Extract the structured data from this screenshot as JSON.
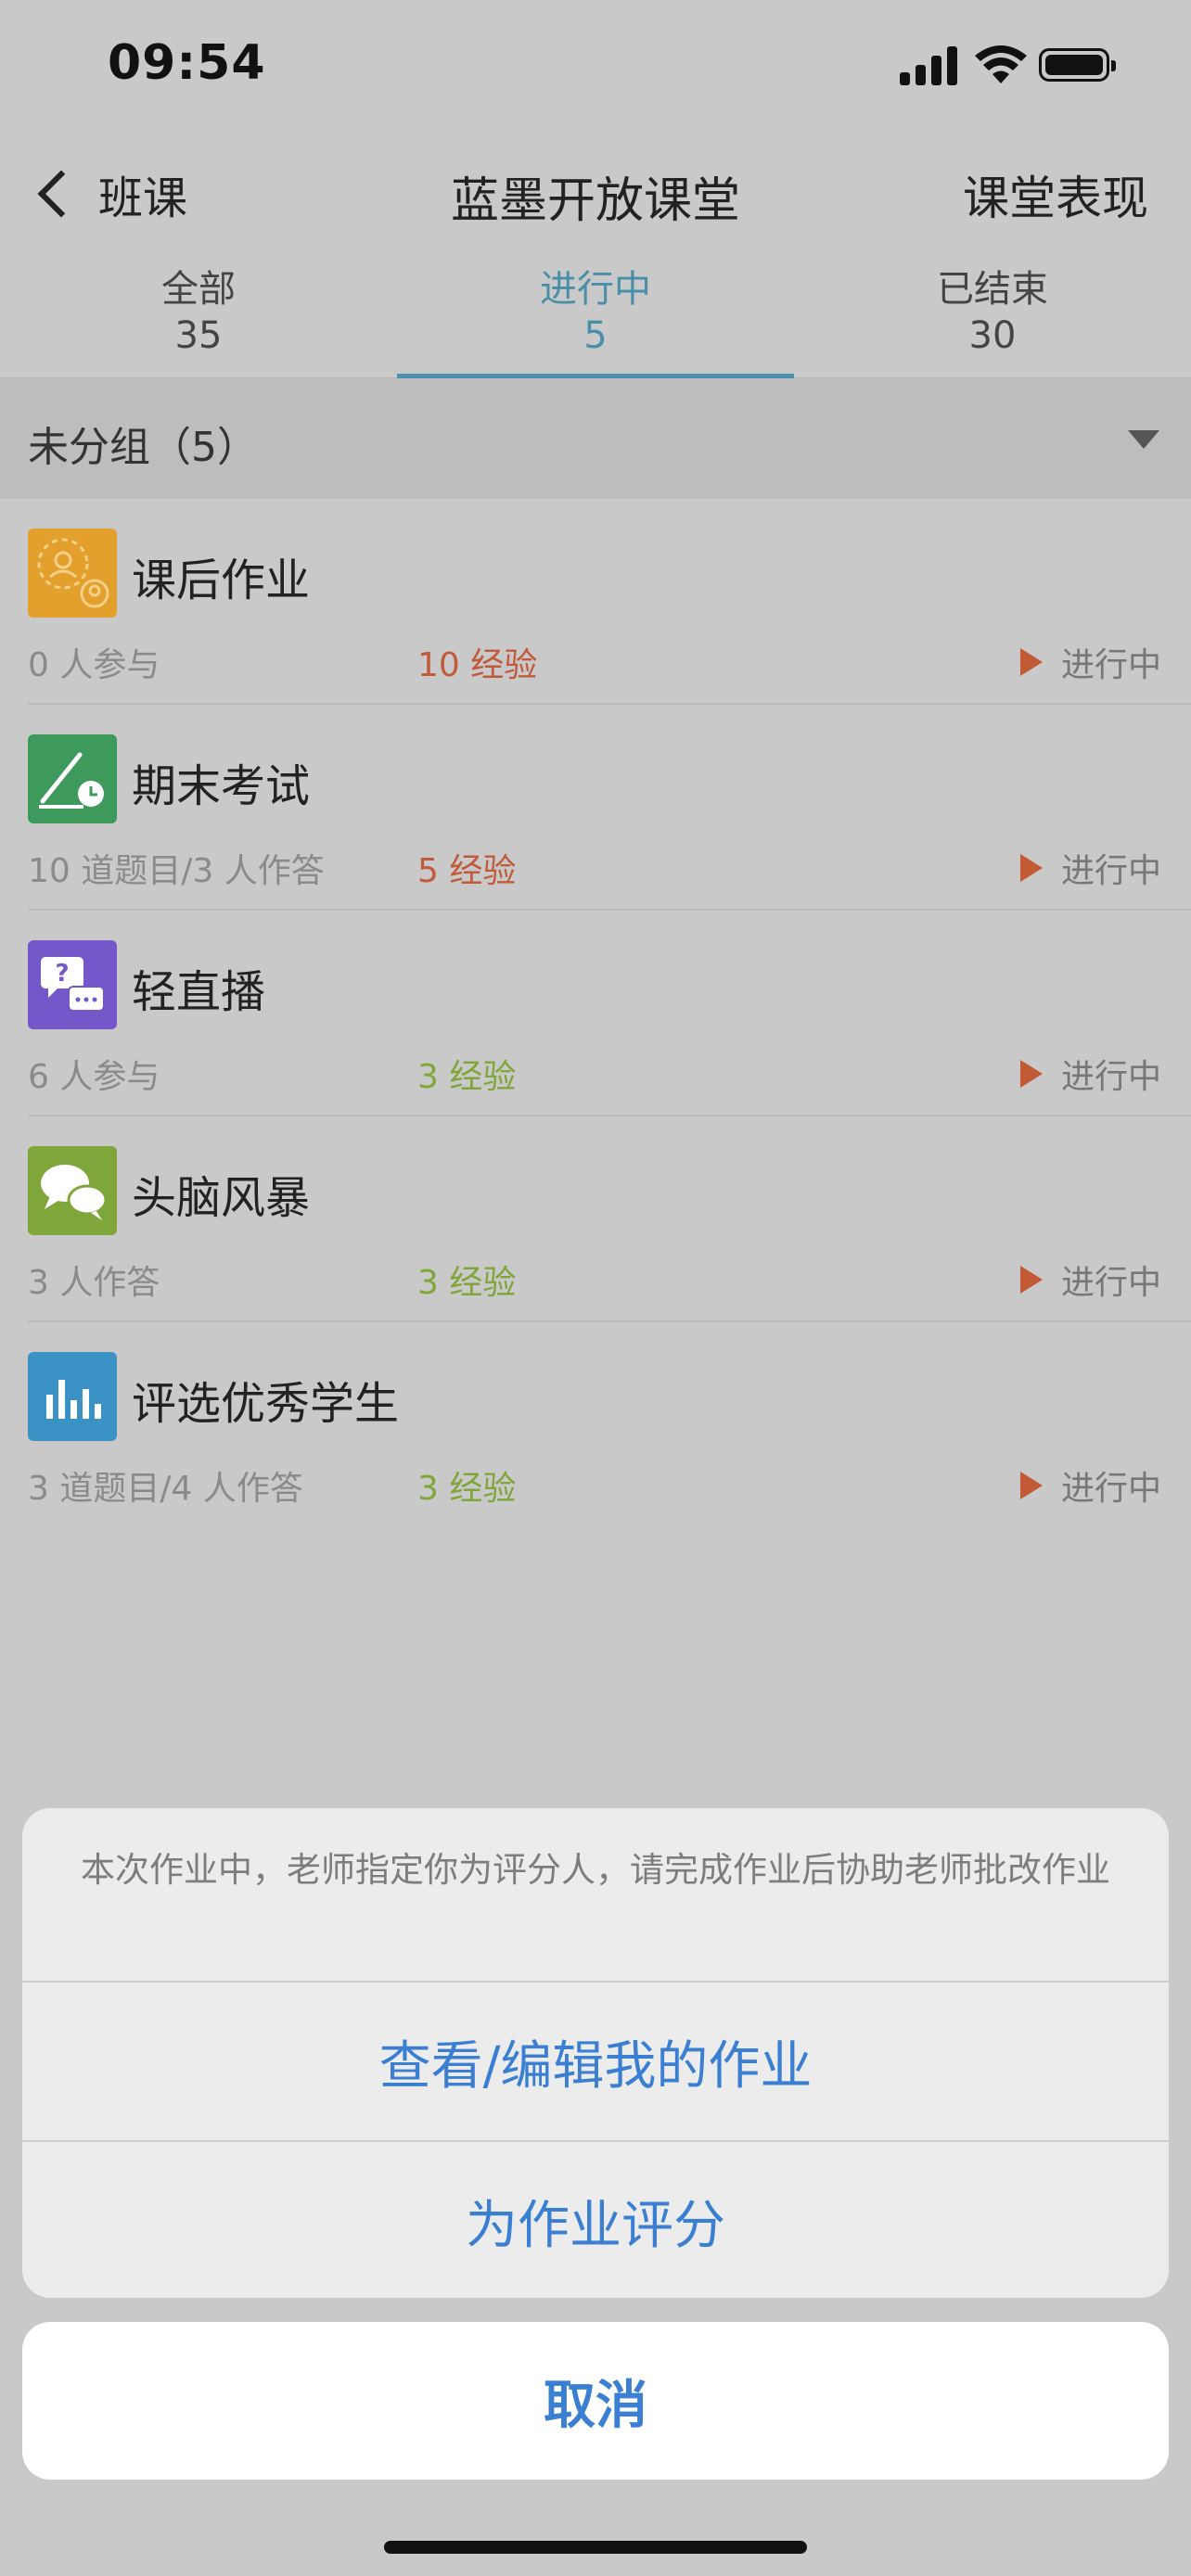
{
  "status_bar": {
    "time": "09:54"
  },
  "nav": {
    "back_label": "班课",
    "title": "蓝墨开放课堂",
    "right_label": "课堂表现"
  },
  "tabs": [
    {
      "label": "全部",
      "count": "35"
    },
    {
      "label": "进行中",
      "count": "5",
      "active": true
    },
    {
      "label": "已结束",
      "count": "30"
    }
  ],
  "group": {
    "label": "未分组（5）"
  },
  "items": [
    {
      "name": "课后作业",
      "meta": "0 人参与",
      "exp": "10 经验",
      "status": "进行中",
      "icon": "group-users-icon"
    },
    {
      "name": "期末考试",
      "meta": "10 道题目/3 人作答",
      "exp": "5 经验",
      "status": "进行中",
      "icon": "pen-clock-icon"
    },
    {
      "name": "轻直播",
      "meta": "6 人参与",
      "exp": "3 经验",
      "status": "进行中",
      "icon": "chat-question-icon"
    },
    {
      "name": "头脑风暴",
      "meta": "3 人作答",
      "exp": "3 经验",
      "status": "进行中",
      "icon": "speech-bubbles-icon"
    },
    {
      "name": "评选优秀学生",
      "meta": "3 道题目/4 人作答",
      "exp": "3 经验",
      "status": "进行中",
      "icon": "bar-chart-icon"
    }
  ],
  "colors": {
    "accent": "#4a90ad",
    "exp_red": "#c05a3a",
    "exp_green": "#80a63a",
    "action_blue": "#3b7fd2"
  },
  "sheet": {
    "message": "本次作业中，老师指定你为评分人，请完成作业后协助老师批改作业",
    "action1": "查看/编辑我的作业",
    "action2": "为作业评分",
    "cancel": "取消"
  }
}
